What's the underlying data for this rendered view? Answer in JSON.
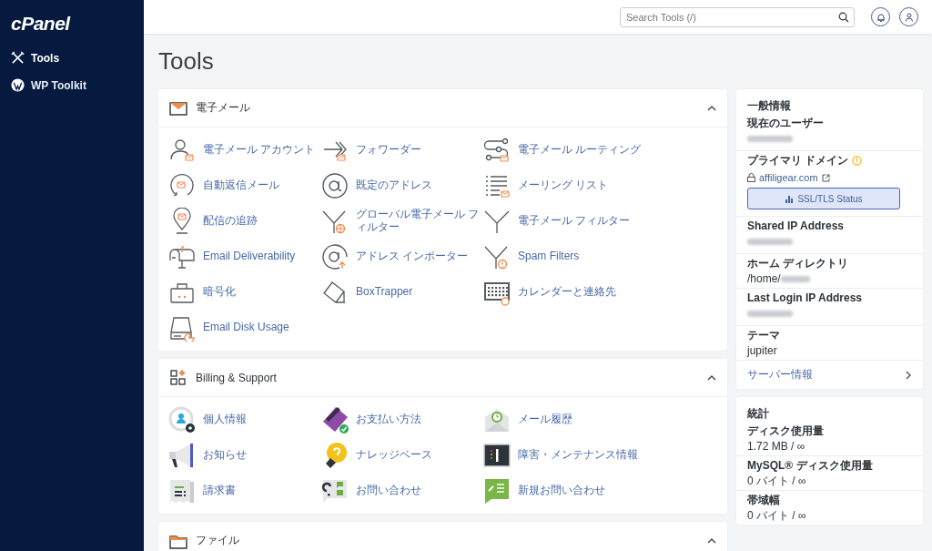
{
  "sidebar": {
    "logo": "cPanel",
    "items": [
      {
        "label": "Tools",
        "selected": true
      },
      {
        "label": "WP Toolkit",
        "selected": false
      }
    ]
  },
  "topbar": {
    "search": {
      "placeholder": "Search Tools (/)"
    }
  },
  "page_title": "Tools",
  "sections": [
    {
      "title": "電子メール",
      "expanded": true,
      "items": [
        {
          "label": "電子メール アカウント"
        },
        {
          "label": "フォワーダー"
        },
        {
          "label": "電子メール ルーティング"
        },
        {
          "label": "自動返信メール"
        },
        {
          "label": "既定のアドレス"
        },
        {
          "label": "メーリング リスト"
        },
        {
          "label": "配信の追跡"
        },
        {
          "label": "グローバル電子メール フィルター"
        },
        {
          "label": "電子メール フィルター"
        },
        {
          "label": "Email Deliverability"
        },
        {
          "label": "アドレス インポーター"
        },
        {
          "label": "Spam Filters"
        },
        {
          "label": "暗号化"
        },
        {
          "label": "BoxTrapper"
        },
        {
          "label": "カレンダーと連絡先"
        },
        {
          "label": "Email Disk Usage"
        }
      ]
    },
    {
      "title": "Billing & Support",
      "expanded": true,
      "items": [
        {
          "label": "個人情報"
        },
        {
          "label": "お支払い方法"
        },
        {
          "label": "メール履歴"
        },
        {
          "label": "お知らせ"
        },
        {
          "label": "ナレッジベース"
        },
        {
          "label": "障害・メンテナンス情報"
        },
        {
          "label": "請求書"
        },
        {
          "label": "お問い合わせ"
        },
        {
          "label": "新規お問い合わせ"
        }
      ]
    },
    {
      "title": "ファイル",
      "expanded": true
    }
  ],
  "general_info": {
    "title": "一般情報",
    "rows": [
      {
        "kind": "value",
        "label": "現在のユーザー",
        "redacted": true
      },
      {
        "kind": "domain",
        "label": "プライマリ ドメイン",
        "warning": true,
        "domain": "affiligear.com",
        "button": "SSL/TLS Status"
      },
      {
        "kind": "value",
        "label": "Shared IP Address",
        "redacted": true
      },
      {
        "kind": "value",
        "label": "ホーム ディレクトリ",
        "value": "/home/",
        "redacted": true
      },
      {
        "kind": "value",
        "label": "Last Login IP Address",
        "redacted": true
      },
      {
        "kind": "value",
        "label": "テーマ",
        "value": "jupiter"
      },
      {
        "kind": "link",
        "label": "サーバー情報"
      }
    ]
  },
  "statistics": {
    "title": "統計",
    "rows": [
      {
        "label": "ディスク使用量",
        "value": "1.72 MB / ∞"
      },
      {
        "label": "MySQL® ディスク使用量",
        "value": "0 バイト / ∞"
      },
      {
        "label": "帯域幅",
        "value": "0 バイト / ∞"
      }
    ]
  }
}
